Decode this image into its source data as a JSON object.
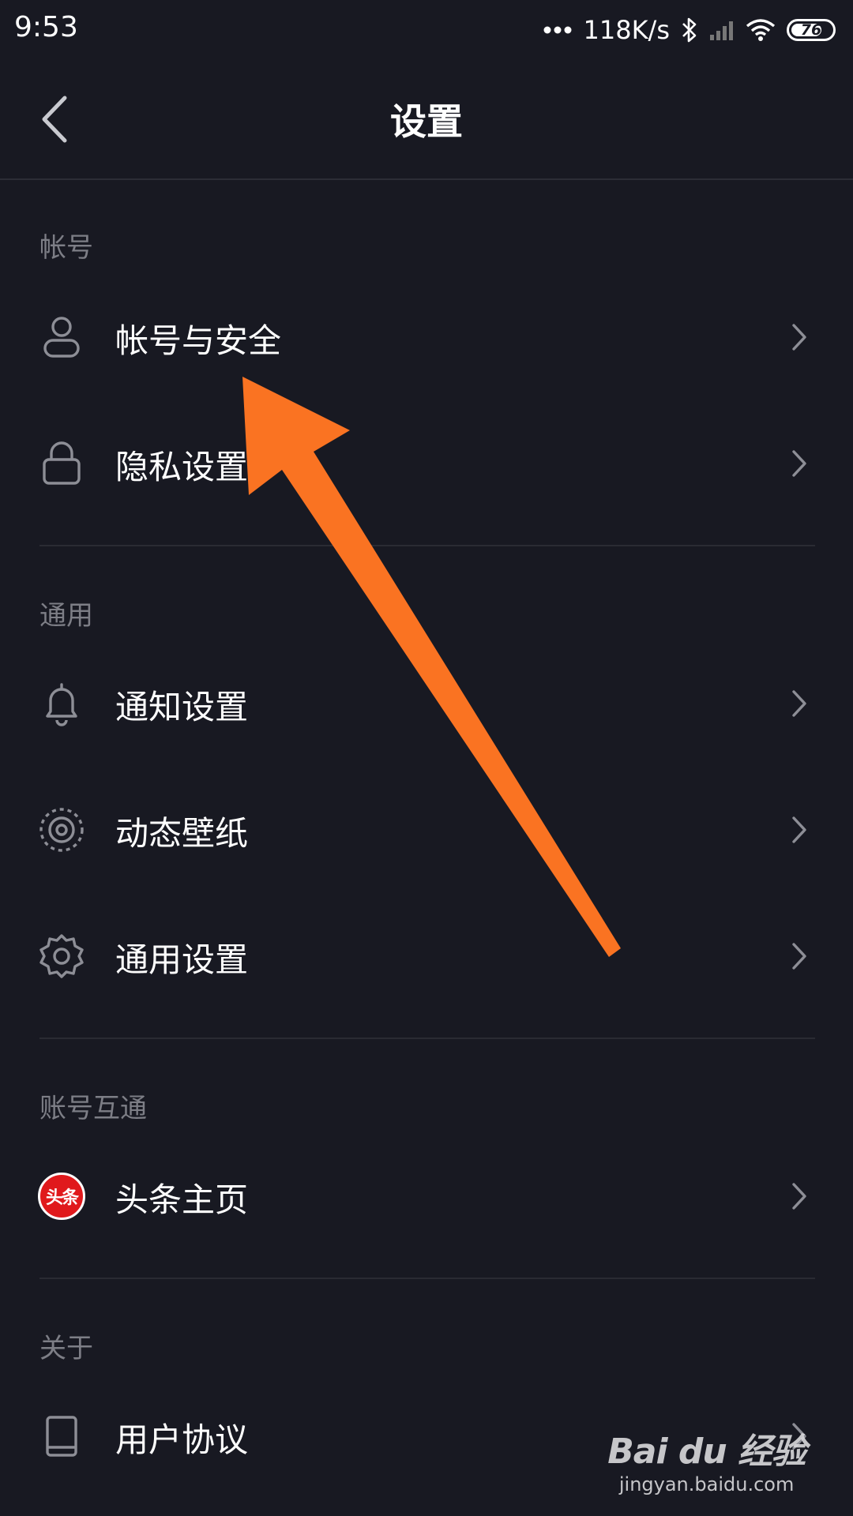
{
  "status_bar": {
    "time": "9:53",
    "network_speed": "118K/s",
    "battery_level": "76",
    "battery_fraction": 0.76,
    "icons": [
      "more-dots-icon",
      "bluetooth-icon",
      "cellular-signal-icon",
      "wifi-icon",
      "battery-icon"
    ]
  },
  "header": {
    "title": "设置",
    "back_icon": "back-arrow-icon"
  },
  "sections": {
    "account": {
      "title": "帐号",
      "items": [
        {
          "label": "帐号与安全",
          "icon": "user-icon"
        },
        {
          "label": "隐私设置",
          "icon": "lock-icon"
        }
      ]
    },
    "general": {
      "title": "通用",
      "items": [
        {
          "label": "通知设置",
          "icon": "bell-icon"
        },
        {
          "label": "动态壁纸",
          "icon": "wallpaper-icon"
        },
        {
          "label": "通用设置",
          "icon": "gear-icon"
        }
      ]
    },
    "linked": {
      "title": "账号互通",
      "items": [
        {
          "label": "头条主页",
          "icon": "toutiao-icon",
          "badge_text": "头条"
        }
      ]
    },
    "about": {
      "title": "关于",
      "items": [
        {
          "label": "用户协议",
          "icon": "book-icon"
        }
      ]
    }
  },
  "watermark": {
    "logo_text": "Bai du 经验",
    "url": "jingyan.baidu.com"
  },
  "colors": {
    "background": "#181922",
    "text_primary": "#ffffff",
    "text_secondary": "#7d7e86",
    "divider": "#2a2b33",
    "annotation_arrow": "#fa7322",
    "toutiao_red": "#e0191c"
  }
}
